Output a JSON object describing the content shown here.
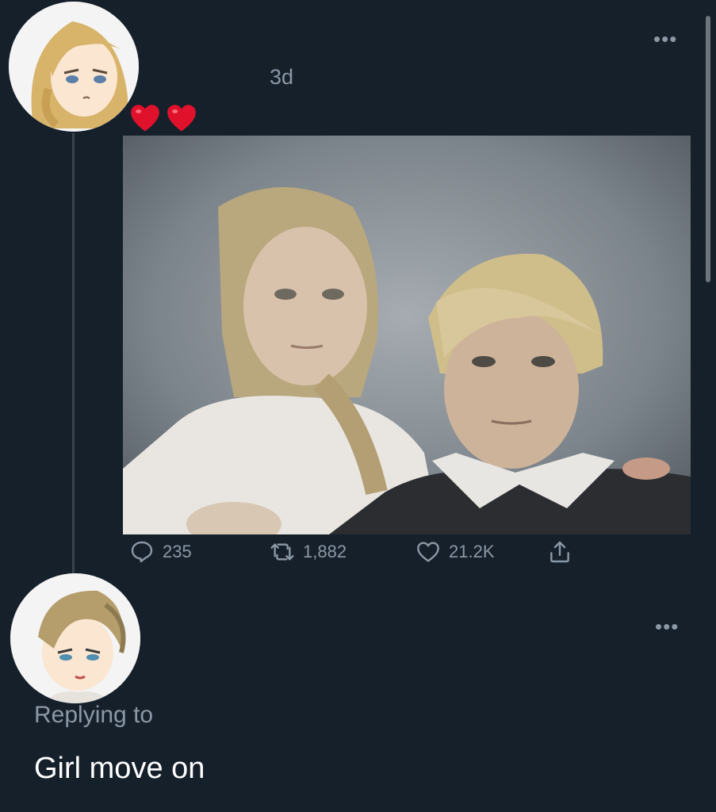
{
  "tweet": {
    "timestamp": "3d",
    "more_icon": "more-horizontal-icon",
    "hearts": [
      "red-heart-emoji",
      "red-heart-emoji"
    ],
    "heart_color": "#e0112b",
    "image_content": "portrait-photo",
    "actions": {
      "replies": "235",
      "retweets": "1,882",
      "likes": "21.2K"
    }
  },
  "reply": {
    "replying_to_label": "Replying to",
    "text": "Girl move on",
    "more_icon": "more-horizontal-icon"
  },
  "theme": {
    "background": "#15202b",
    "muted_text": "#8b98a5",
    "thread_line": "#38444d"
  }
}
